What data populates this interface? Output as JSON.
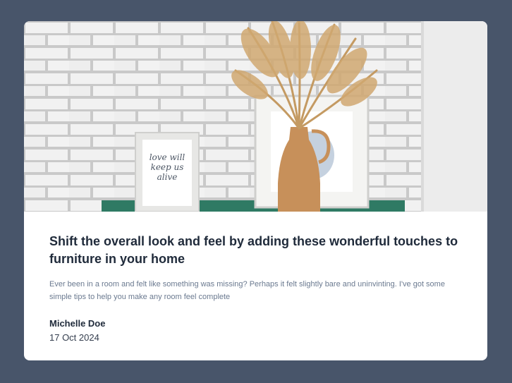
{
  "article": {
    "image_alt": "Pampas grass in a ceramic vase beside a framed print reading love will keep us alive",
    "image_text": "love will keep us alive",
    "title": "Shift the overall look and feel by adding these wonderful touches to furniture in your home",
    "description": "Ever been in a room and felt like something was missing? Perhaps it felt slightly bare and uninvinting. I've got some simple tips to help you make any room feel complete",
    "author": "Michelle Doe",
    "date": "17 Oct 2024"
  },
  "colors": {
    "background": "#48556a",
    "card": "#ffffff",
    "title": "#1f2a3a",
    "description": "#6b7a90"
  }
}
